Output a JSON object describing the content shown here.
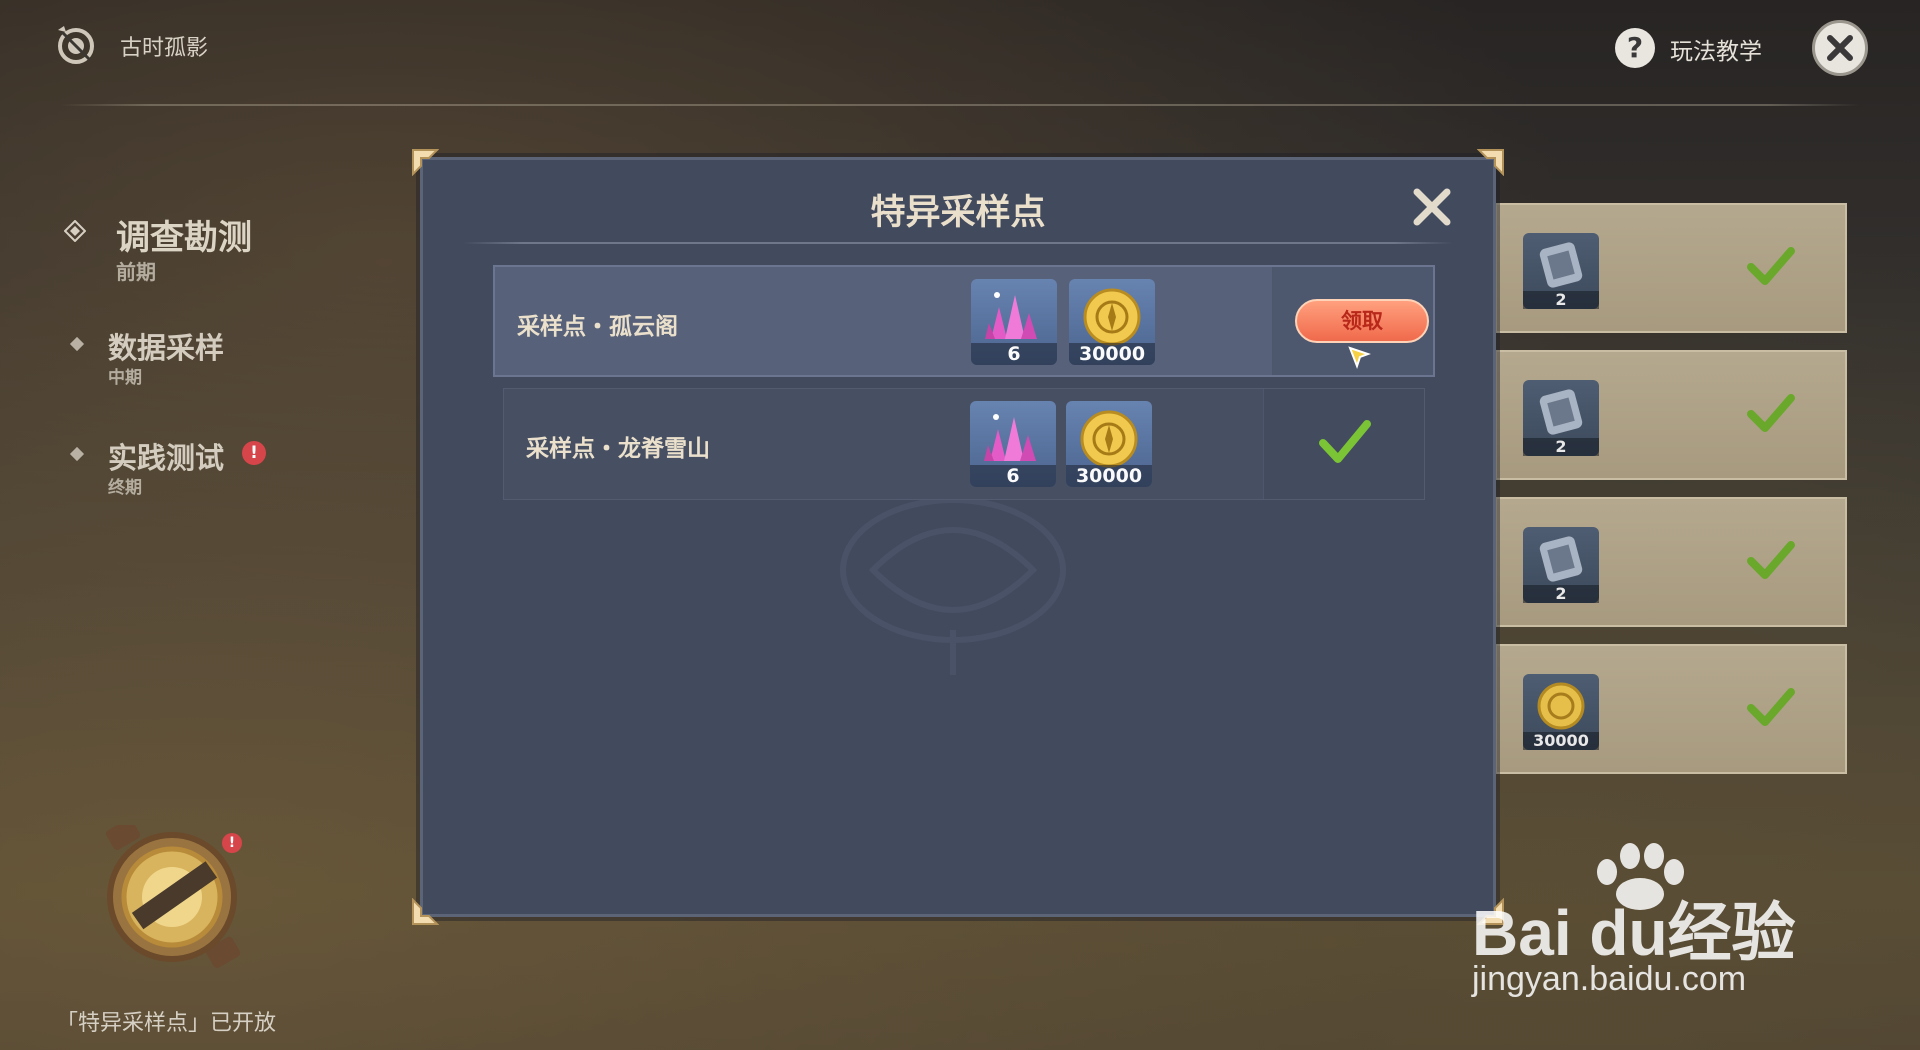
{
  "header": {
    "event_title": "古时孤影",
    "help_label": "玩法教学"
  },
  "sidebar": {
    "items": [
      {
        "title": "调查勘测",
        "sub": "前期",
        "active": true
      },
      {
        "title": "数据采样",
        "sub": "中期",
        "active": false
      },
      {
        "title": "实践测试",
        "sub": "终期",
        "active": false,
        "alert": "!"
      }
    ],
    "compass_alert": "!",
    "footer_note": "「特异采样点」已开放"
  },
  "background_cards": [
    {
      "qty": "2",
      "icon": "stone-tablet-icon",
      "claimed": true
    },
    {
      "qty": "2",
      "icon": "stone-tablet-icon",
      "claimed": true
    },
    {
      "qty": "2",
      "icon": "stone-tablet-icon",
      "claimed": true
    },
    {
      "qty": "30000",
      "icon": "mora-coin-icon",
      "claimed": true
    }
  ],
  "modal": {
    "title": "特异采样点",
    "rows": [
      {
        "name": "采样点・孤云阁",
        "rewards": [
          {
            "icon": "crystal-ore-icon",
            "qty": "6"
          },
          {
            "icon": "mora-coin-icon",
            "qty": "30000"
          }
        ],
        "claimed": false,
        "action_label": "领取"
      },
      {
        "name": "采样点・龙脊雪山",
        "rewards": [
          {
            "icon": "crystal-ore-icon",
            "qty": "6"
          },
          {
            "icon": "mora-coin-icon",
            "qty": "30000"
          }
        ],
        "claimed": true
      }
    ]
  },
  "watermark": {
    "brand": "Bai du经验",
    "url": "jingyan.baidu.com"
  },
  "colors": {
    "accent_claim": "#f06a4c",
    "check_green": "#7ac436",
    "modal_bg": "#424a5e"
  }
}
